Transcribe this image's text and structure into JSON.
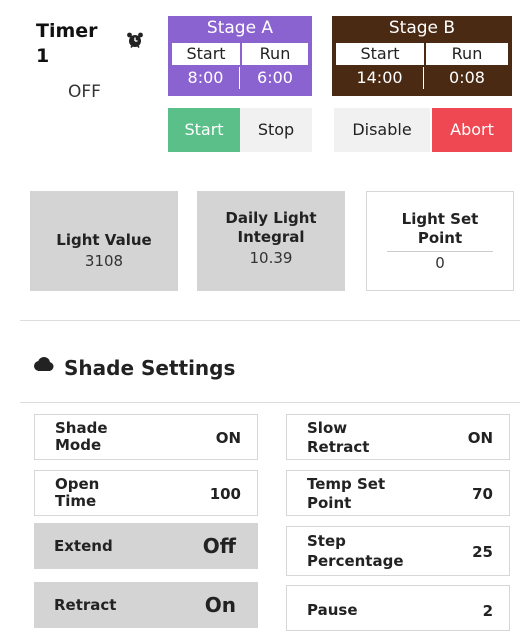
{
  "timer": {
    "title": "Timer",
    "number": "1",
    "status": "OFF",
    "icon": "alarm-clock-icon"
  },
  "stage_a": {
    "title": "Stage A",
    "start_label": "Start",
    "run_label": "Run",
    "start_value": "8:00",
    "run_value": "6:00",
    "color": "#8b63d1"
  },
  "stage_b": {
    "title": "Stage B",
    "start_label": "Start",
    "run_label": "Run",
    "start_value": "14:00",
    "run_value": "0:08",
    "color": "#4a2a12"
  },
  "buttons": {
    "start": "Start",
    "stop": "Stop",
    "disable": "Disable",
    "abort": "Abort"
  },
  "light": {
    "light_value_label": "Light Value",
    "light_value": "3108",
    "dli_label_1": "Daily Light",
    "dli_label_2": "Integral",
    "dli_value": "10.39",
    "setpoint_label_1": "Light Set",
    "setpoint_label_2": "Point",
    "setpoint_value": "0"
  },
  "shade": {
    "title": "Shade Settings",
    "icon": "cloud-icon",
    "left_rows": [
      {
        "label_1": "Shade",
        "label_2": "Mode",
        "value": "ON"
      },
      {
        "label_1": "Open",
        "label_2": "Time",
        "value": "100"
      },
      {
        "label_1": "Extend",
        "label_2": "",
        "value": "Off"
      },
      {
        "label_1": "Retract",
        "label_2": "",
        "value": "On"
      }
    ],
    "right_rows": [
      {
        "label_1": "Slow",
        "label_2": "Retract",
        "value": "ON"
      },
      {
        "label_1": "Temp Set",
        "label_2": "Point",
        "value": "70"
      },
      {
        "label_1": "Step",
        "label_2": "Percentage",
        "value": "25"
      },
      {
        "label_1": "Pause",
        "label_2": "",
        "value": "2"
      }
    ]
  }
}
